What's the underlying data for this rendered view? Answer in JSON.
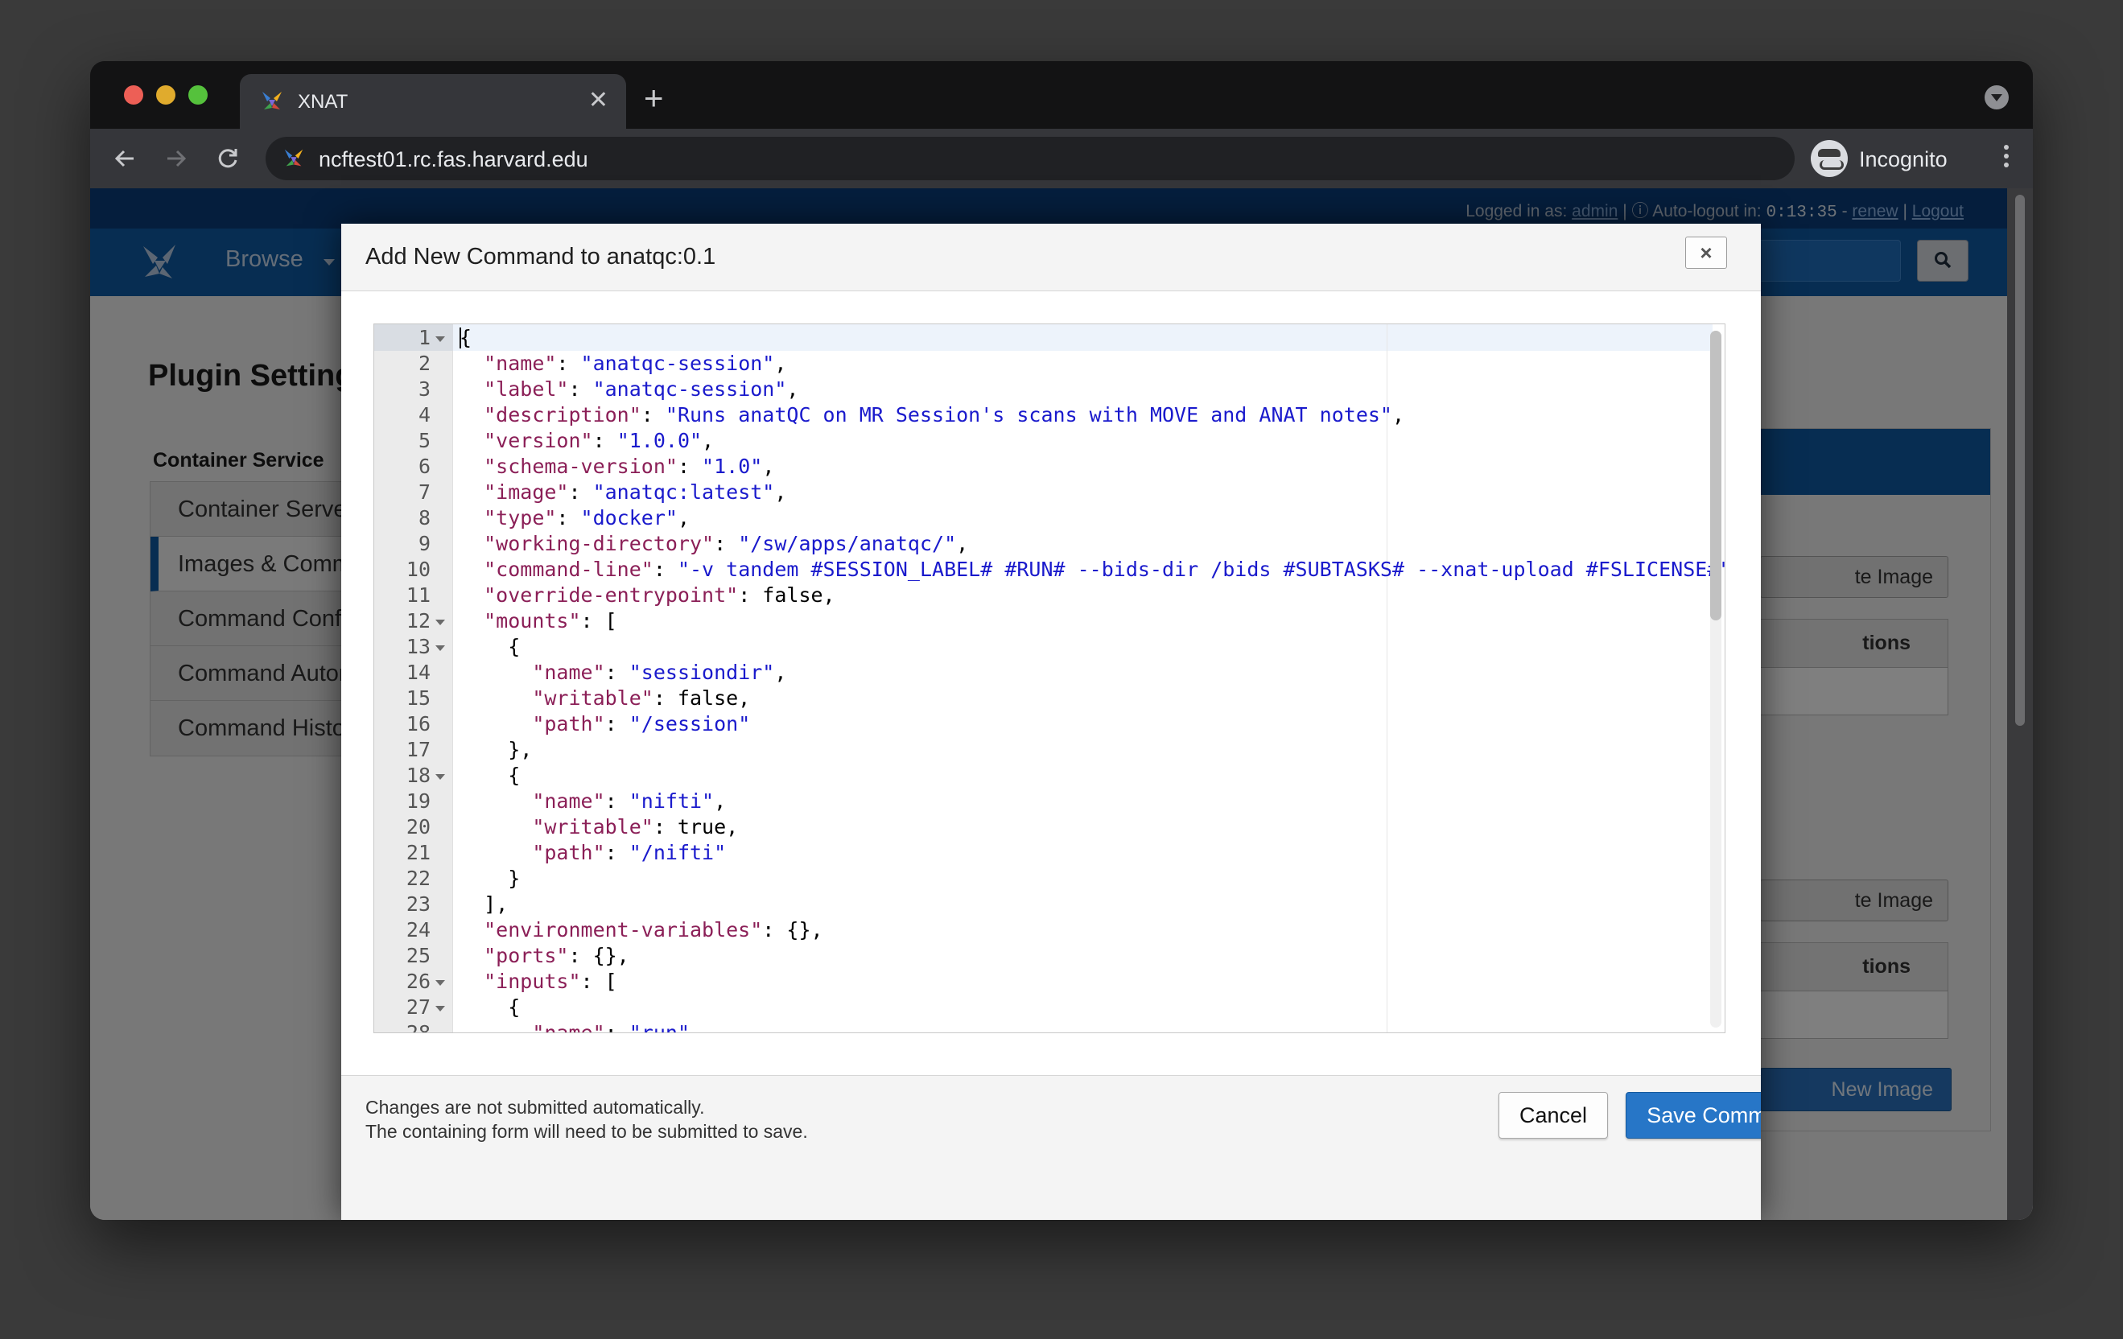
{
  "browser": {
    "tab_title": "XNAT",
    "tab_close": "✕",
    "new_tab": "+",
    "url": "ncftest01.rc.fas.harvard.edu",
    "incognito_label": "Incognito",
    "back_icon": "back-arrow-icon",
    "forward_icon": "forward-arrow-icon",
    "reload_icon": "reload-icon"
  },
  "topbar": {
    "logged_in_as": "Logged in as:",
    "username": "admin",
    "separator": "|",
    "auto_logout": "Auto-logout in:",
    "timer": "0:13:35",
    "dash": "-",
    "renew": "renew",
    "logout": "Logout"
  },
  "nav": {
    "browse": "Browse"
  },
  "page": {
    "title": "Plugin Settings",
    "sidebar_heading": "Container Service",
    "sidebar_items": [
      {
        "label": "Container Server Setup",
        "active": false
      },
      {
        "label": "Images & Commands",
        "active": true
      },
      {
        "label": "Command Configurations",
        "active": false
      },
      {
        "label": "Command Automation",
        "active": false
      },
      {
        "label": "Command History",
        "active": false
      }
    ],
    "right_panel": {
      "buttons": [
        "te Image",
        "te Image"
      ],
      "table_headers": [
        "tions",
        "tions"
      ],
      "new_image": "New Image"
    }
  },
  "modal": {
    "title": "Add New Command to anatqc:0.1",
    "close_label": "×",
    "footer_note_line1": "Changes are not submitted automatically.",
    "footer_note_line2": "The containing form will need to be submitted to save.",
    "cancel_label": "Cancel",
    "save_label": "Save Command"
  },
  "editor": {
    "lines": [
      {
        "n": "1",
        "fold": true,
        "tokens": [
          {
            "t": "{",
            "c": "p"
          }
        ]
      },
      {
        "n": "2",
        "fold": false,
        "tokens": [
          {
            "t": "  ",
            "c": "p"
          },
          {
            "t": "\"name\"",
            "c": "key"
          },
          {
            "t": ": ",
            "c": "p"
          },
          {
            "t": "\"anatqc-session\"",
            "c": "str"
          },
          {
            "t": ",",
            "c": "p"
          }
        ]
      },
      {
        "n": "3",
        "fold": false,
        "tokens": [
          {
            "t": "  ",
            "c": "p"
          },
          {
            "t": "\"label\"",
            "c": "key"
          },
          {
            "t": ": ",
            "c": "p"
          },
          {
            "t": "\"anatqc-session\"",
            "c": "str"
          },
          {
            "t": ",",
            "c": "p"
          }
        ]
      },
      {
        "n": "4",
        "fold": false,
        "tokens": [
          {
            "t": "  ",
            "c": "p"
          },
          {
            "t": "\"description\"",
            "c": "key"
          },
          {
            "t": ": ",
            "c": "p"
          },
          {
            "t": "\"Runs anatQC on MR Session's scans with MOVE and ANAT notes\"",
            "c": "str"
          },
          {
            "t": ",",
            "c": "p"
          }
        ]
      },
      {
        "n": "5",
        "fold": false,
        "tokens": [
          {
            "t": "  ",
            "c": "p"
          },
          {
            "t": "\"version\"",
            "c": "key"
          },
          {
            "t": ": ",
            "c": "p"
          },
          {
            "t": "\"1.0.0\"",
            "c": "str"
          },
          {
            "t": ",",
            "c": "p"
          }
        ]
      },
      {
        "n": "6",
        "fold": false,
        "tokens": [
          {
            "t": "  ",
            "c": "p"
          },
          {
            "t": "\"schema-version\"",
            "c": "key"
          },
          {
            "t": ": ",
            "c": "p"
          },
          {
            "t": "\"1.0\"",
            "c": "str"
          },
          {
            "t": ",",
            "c": "p"
          }
        ]
      },
      {
        "n": "7",
        "fold": false,
        "tokens": [
          {
            "t": "  ",
            "c": "p"
          },
          {
            "t": "\"image\"",
            "c": "key"
          },
          {
            "t": ": ",
            "c": "p"
          },
          {
            "t": "\"anatqc:latest\"",
            "c": "str"
          },
          {
            "t": ",",
            "c": "p"
          }
        ]
      },
      {
        "n": "8",
        "fold": false,
        "tokens": [
          {
            "t": "  ",
            "c": "p"
          },
          {
            "t": "\"type\"",
            "c": "key"
          },
          {
            "t": ": ",
            "c": "p"
          },
          {
            "t": "\"docker\"",
            "c": "str"
          },
          {
            "t": ",",
            "c": "p"
          }
        ]
      },
      {
        "n": "9",
        "fold": false,
        "tokens": [
          {
            "t": "  ",
            "c": "p"
          },
          {
            "t": "\"working-directory\"",
            "c": "key"
          },
          {
            "t": ": ",
            "c": "p"
          },
          {
            "t": "\"/sw/apps/anatqc/\"",
            "c": "str"
          },
          {
            "t": ",",
            "c": "p"
          }
        ]
      },
      {
        "n": "10",
        "fold": false,
        "tokens": [
          {
            "t": "  ",
            "c": "p"
          },
          {
            "t": "\"command-line\"",
            "c": "key"
          },
          {
            "t": ": ",
            "c": "p"
          },
          {
            "t": "\"-v tandem #SESSION_LABEL# #RUN# --bids-dir /bids #SUBTASKS# --xnat-upload #FSLICENSE#\"",
            "c": "str"
          },
          {
            "t": ",",
            "c": "p"
          }
        ]
      },
      {
        "n": "11",
        "fold": false,
        "tokens": [
          {
            "t": "  ",
            "c": "p"
          },
          {
            "t": "\"override-entrypoint\"",
            "c": "key"
          },
          {
            "t": ": false,",
            "c": "p"
          }
        ]
      },
      {
        "n": "12",
        "fold": true,
        "tokens": [
          {
            "t": "  ",
            "c": "p"
          },
          {
            "t": "\"mounts\"",
            "c": "key"
          },
          {
            "t": ": [",
            "c": "p"
          }
        ]
      },
      {
        "n": "13",
        "fold": true,
        "tokens": [
          {
            "t": "    {",
            "c": "p"
          }
        ]
      },
      {
        "n": "14",
        "fold": false,
        "tokens": [
          {
            "t": "      ",
            "c": "p"
          },
          {
            "t": "\"name\"",
            "c": "key"
          },
          {
            "t": ": ",
            "c": "p"
          },
          {
            "t": "\"sessiondir\"",
            "c": "str"
          },
          {
            "t": ",",
            "c": "p"
          }
        ]
      },
      {
        "n": "15",
        "fold": false,
        "tokens": [
          {
            "t": "      ",
            "c": "p"
          },
          {
            "t": "\"writable\"",
            "c": "key"
          },
          {
            "t": ": false,",
            "c": "p"
          }
        ]
      },
      {
        "n": "16",
        "fold": false,
        "tokens": [
          {
            "t": "      ",
            "c": "p"
          },
          {
            "t": "\"path\"",
            "c": "key"
          },
          {
            "t": ": ",
            "c": "p"
          },
          {
            "t": "\"/session\"",
            "c": "str"
          }
        ]
      },
      {
        "n": "17",
        "fold": false,
        "tokens": [
          {
            "t": "    },",
            "c": "p"
          }
        ]
      },
      {
        "n": "18",
        "fold": true,
        "tokens": [
          {
            "t": "    {",
            "c": "p"
          }
        ]
      },
      {
        "n": "19",
        "fold": false,
        "tokens": [
          {
            "t": "      ",
            "c": "p"
          },
          {
            "t": "\"name\"",
            "c": "key"
          },
          {
            "t": ": ",
            "c": "p"
          },
          {
            "t": "\"nifti\"",
            "c": "str"
          },
          {
            "t": ",",
            "c": "p"
          }
        ]
      },
      {
        "n": "20",
        "fold": false,
        "tokens": [
          {
            "t": "      ",
            "c": "p"
          },
          {
            "t": "\"writable\"",
            "c": "key"
          },
          {
            "t": ": true,",
            "c": "p"
          }
        ]
      },
      {
        "n": "21",
        "fold": false,
        "tokens": [
          {
            "t": "      ",
            "c": "p"
          },
          {
            "t": "\"path\"",
            "c": "key"
          },
          {
            "t": ": ",
            "c": "p"
          },
          {
            "t": "\"/nifti\"",
            "c": "str"
          }
        ]
      },
      {
        "n": "22",
        "fold": false,
        "tokens": [
          {
            "t": "    }",
            "c": "p"
          }
        ]
      },
      {
        "n": "23",
        "fold": false,
        "tokens": [
          {
            "t": "  ],",
            "c": "p"
          }
        ]
      },
      {
        "n": "24",
        "fold": false,
        "tokens": [
          {
            "t": "  ",
            "c": "p"
          },
          {
            "t": "\"environment-variables\"",
            "c": "key"
          },
          {
            "t": ": {},",
            "c": "p"
          }
        ]
      },
      {
        "n": "25",
        "fold": false,
        "tokens": [
          {
            "t": "  ",
            "c": "p"
          },
          {
            "t": "\"ports\"",
            "c": "key"
          },
          {
            "t": ": {},",
            "c": "p"
          }
        ]
      },
      {
        "n": "26",
        "fold": true,
        "tokens": [
          {
            "t": "  ",
            "c": "p"
          },
          {
            "t": "\"inputs\"",
            "c": "key"
          },
          {
            "t": ": [",
            "c": "p"
          }
        ]
      },
      {
        "n": "27",
        "fold": true,
        "tokens": [
          {
            "t": "    {",
            "c": "p"
          }
        ]
      },
      {
        "n": "28",
        "fold": false,
        "tokens": [
          {
            "t": "      ",
            "c": "p"
          },
          {
            "t": "\"name\"",
            "c": "key"
          },
          {
            "t": ": ",
            "c": "p"
          },
          {
            "t": "\"run\"",
            "c": "str"
          },
          {
            "t": ",",
            "c": "p"
          }
        ]
      }
    ]
  },
  "colors": {
    "xnat_blue": "#0f5ba4",
    "save_button": "#2776c7",
    "json_key": "#8b1f57",
    "json_string": "#1a1acc"
  }
}
